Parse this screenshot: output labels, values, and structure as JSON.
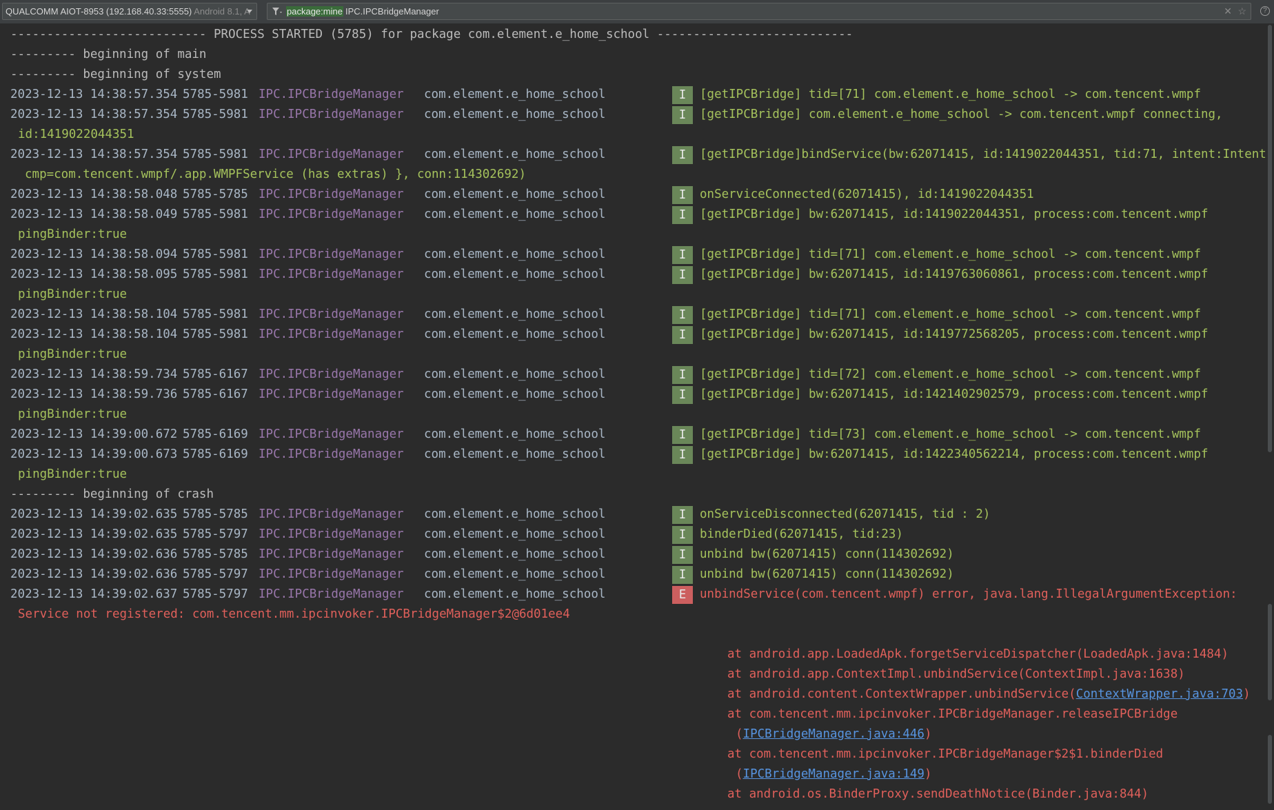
{
  "toolbar": {
    "device_name": "QUALCOMM AIOT-8953 (192.168.40.33:5555)",
    "device_os": "Android 8.1, A",
    "filter_key": "package:mine",
    "filter_value": "IPC.IPCBridgeManager",
    "clear_glyph": "✕",
    "star_glyph": "☆",
    "help_glyph": "?"
  },
  "log": {
    "process_started": "--------------------------- PROCESS STARTED (5785) for package com.element.e_home_school ---------------------------",
    "main_header": "--------- beginning of main",
    "system_header": "--------- beginning of system",
    "crash_header": "--------- beginning of crash",
    "tag": "IPC.IPCBridgeManager",
    "package": "com.element.e_home_school",
    "entries": [
      {
        "ts": "2023-12-13 14:38:57.354",
        "pid": "5785-5981",
        "level": "I",
        "msg": "[getIPCBridge] tid=[71] com.element.e_home_school -> com.tencent.wmpf"
      },
      {
        "ts": "2023-12-13 14:38:57.354",
        "pid": "5785-5981",
        "level": "I",
        "msg": "[getIPCBridge] com.element.e_home_school -> com.tencent.wmpf connecting,",
        "cont": "id:1419022044351"
      },
      {
        "ts": "2023-12-13 14:38:57.354",
        "pid": "5785-5981",
        "level": "I",
        "msg": "[getIPCBridge]bindService(bw:62071415, id:1419022044351, tid:71, intent:Intent {",
        "cont": "cmp=com.tencent.wmpf/.app.WMPFService (has extras) }, conn:114302692)"
      },
      {
        "ts": "2023-12-13 14:38:58.048",
        "pid": "5785-5785",
        "level": "I",
        "msg": "onServiceConnected(62071415), id:1419022044351"
      },
      {
        "ts": "2023-12-13 14:38:58.049",
        "pid": "5785-5981",
        "level": "I",
        "msg": "[getIPCBridge] bw:62071415, id:1419022044351, process:com.tencent.wmpf",
        "cont": "pingBinder:true"
      },
      {
        "ts": "2023-12-13 14:38:58.094",
        "pid": "5785-5981",
        "level": "I",
        "msg": "[getIPCBridge] tid=[71] com.element.e_home_school -> com.tencent.wmpf"
      },
      {
        "ts": "2023-12-13 14:38:58.095",
        "pid": "5785-5981",
        "level": "I",
        "msg": "[getIPCBridge] bw:62071415, id:1419763060861, process:com.tencent.wmpf",
        "cont": "pingBinder:true"
      },
      {
        "ts": "2023-12-13 14:38:58.104",
        "pid": "5785-5981",
        "level": "I",
        "msg": "[getIPCBridge] tid=[71] com.element.e_home_school -> com.tencent.wmpf"
      },
      {
        "ts": "2023-12-13 14:38:58.104",
        "pid": "5785-5981",
        "level": "I",
        "msg": "[getIPCBridge] bw:62071415, id:1419772568205, process:com.tencent.wmpf",
        "cont": "pingBinder:true"
      },
      {
        "ts": "2023-12-13 14:38:59.734",
        "pid": "5785-6167",
        "level": "I",
        "msg": "[getIPCBridge] tid=[72] com.element.e_home_school -> com.tencent.wmpf"
      },
      {
        "ts": "2023-12-13 14:38:59.736",
        "pid": "5785-6167",
        "level": "I",
        "msg": "[getIPCBridge] bw:62071415, id:1421402902579, process:com.tencent.wmpf",
        "cont": "pingBinder:true"
      },
      {
        "ts": "2023-12-13 14:39:00.672",
        "pid": "5785-6169",
        "level": "I",
        "msg": "[getIPCBridge] tid=[73] com.element.e_home_school -> com.tencent.wmpf"
      },
      {
        "ts": "2023-12-13 14:39:00.673",
        "pid": "5785-6169",
        "level": "I",
        "msg": "[getIPCBridge] bw:62071415, id:1422340562214, process:com.tencent.wmpf",
        "cont": "pingBinder:true"
      }
    ],
    "crash_entries": [
      {
        "ts": "2023-12-13 14:39:02.635",
        "pid": "5785-5785",
        "level": "I",
        "msg": "onServiceDisconnected(62071415, tid : 2)"
      },
      {
        "ts": "2023-12-13 14:39:02.635",
        "pid": "5785-5797",
        "level": "I",
        "msg": "binderDied(62071415, tid:23)"
      },
      {
        "ts": "2023-12-13 14:39:02.636",
        "pid": "5785-5785",
        "level": "I",
        "msg": "unbind bw(62071415) conn(114302692)"
      },
      {
        "ts": "2023-12-13 14:39:02.636",
        "pid": "5785-5797",
        "level": "I",
        "msg": "unbind bw(62071415) conn(114302692)"
      },
      {
        "ts": "2023-12-13 14:39:02.637",
        "pid": "5785-5797",
        "level": "E",
        "msg": "unbindService(com.tencent.wmpf) error, java.lang.IllegalArgumentException:",
        "cont": "Service not registered: com.tencent.mm.ipcinvoker.IPCBridgeManager$2@6d01ee4"
      }
    ],
    "stack": {
      "s1": "at android.app.LoadedApk.forgetServiceDispatcher(LoadedApk.java:1484)",
      "s2": "at android.app.ContextImpl.unbindService(ContextImpl.java:1638)",
      "s3_pre": "at android.content.ContextWrapper.unbindService(",
      "s3_link": "ContextWrapper.java:703",
      "s3_post": ")",
      "s4": "at com.tencent.mm.ipcinvoker.IPCBridgeManager.releaseIPCBridge",
      "s4_open": "(",
      "s4_link": "IPCBridgeManager.java:446",
      "s4_close": ")",
      "s5": "at com.tencent.mm.ipcinvoker.IPCBridgeManager$2$1.binderDied",
      "s5_open": "(",
      "s5_link": "IPCBridgeManager.java:149",
      "s5_close": ")",
      "s6": "at android.os.BinderProxy.sendDeathNotice(Binder.java:844)"
    }
  },
  "colors": {
    "background": "#2b2b2b",
    "info_badge": "#6a8759",
    "error_badge": "#cc5f5f",
    "info_text": "#a5c25c",
    "error_text": "#e0605b",
    "tag_text": "#9876aa",
    "link": "#5794e0"
  }
}
